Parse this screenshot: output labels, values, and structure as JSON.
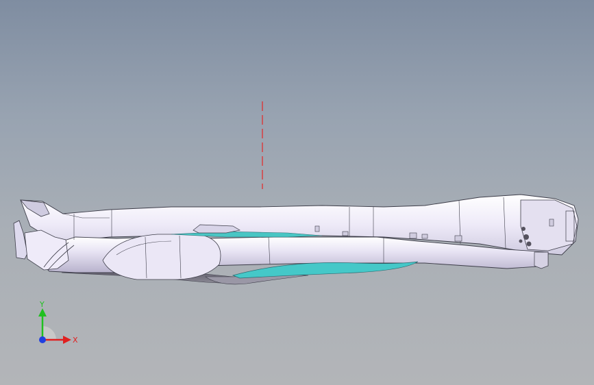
{
  "viewport": {
    "background_top": "#7f8da1",
    "background_bottom": "#b3b5b8"
  },
  "model": {
    "body_color": "#f0eefa",
    "edge_color": "#3c3c48",
    "accent_color": "#45c8c8",
    "centerline_color": "#e03030"
  },
  "triad": {
    "x_label": "X",
    "y_label": "Y",
    "x_color": "#e02020",
    "y_color": "#20c020",
    "z_color": "#2040e0"
  }
}
